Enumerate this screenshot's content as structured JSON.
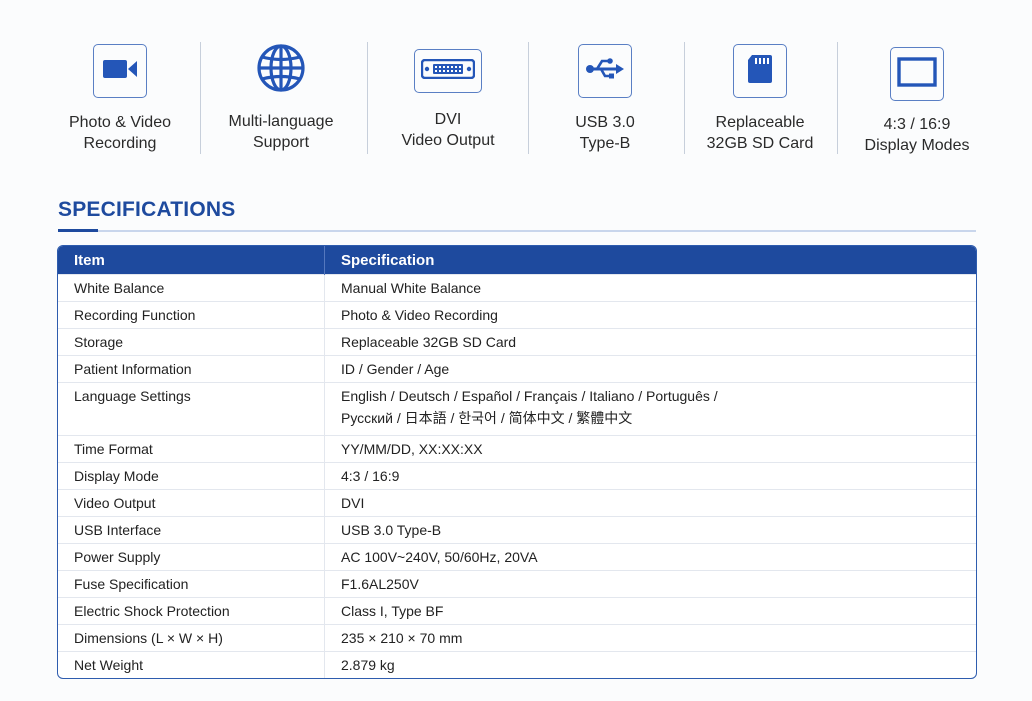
{
  "features": [
    {
      "icon": "video-camera-icon",
      "line1": "Photo & Video",
      "line2": "Recording"
    },
    {
      "icon": "globe-icon",
      "line1": "Multi-language",
      "line2": "Support"
    },
    {
      "icon": "dvi-connector-icon",
      "line1": "DVI",
      "line2": "Video Output"
    },
    {
      "icon": "usb-icon",
      "line1": "USB 3.0",
      "line2": "Type-B"
    },
    {
      "icon": "sd-card-icon",
      "line1": "Replaceable",
      "line2": "32GB SD Card"
    },
    {
      "icon": "display-icon",
      "line1": "4:3 / 16:9",
      "line2": "Display Modes"
    }
  ],
  "section_title": "SPECIFICATIONS",
  "colors": {
    "accent": "#1e4a9e",
    "icon": "#2456b8"
  },
  "table": {
    "headers": [
      "Item",
      "Specification"
    ],
    "rows": [
      [
        "White Balance",
        "Manual White Balance"
      ],
      [
        "Recording Function",
        "Photo & Video Recording"
      ],
      [
        "Storage",
        "Replaceable 32GB SD Card"
      ],
      [
        "Patient Information",
        "ID / Gender / Age"
      ],
      [
        "Language Settings",
        "English / Deutsch / Español / Français / Italiano / Português /",
        "Русский / 日本語 / 한국어 / 简体中文 / 繁體中文"
      ],
      [
        "Time Format",
        "YY/MM/DD, XX:XX:XX"
      ],
      [
        "Display Mode",
        "4:3 / 16:9"
      ],
      [
        "Video Output",
        "DVI"
      ],
      [
        "USB Interface",
        "USB 3.0 Type-B"
      ],
      [
        "Power Supply",
        "AC 100V~240V, 50/60Hz, 20VA"
      ],
      [
        "Fuse Specification",
        "F1.6AL250V"
      ],
      [
        "Electric Shock Protection",
        "Class I, Type BF"
      ],
      [
        "Dimensions (L × W × H)",
        "235 × 210 × 70 mm"
      ],
      [
        "Net Weight",
        "2.879 kg"
      ]
    ]
  }
}
